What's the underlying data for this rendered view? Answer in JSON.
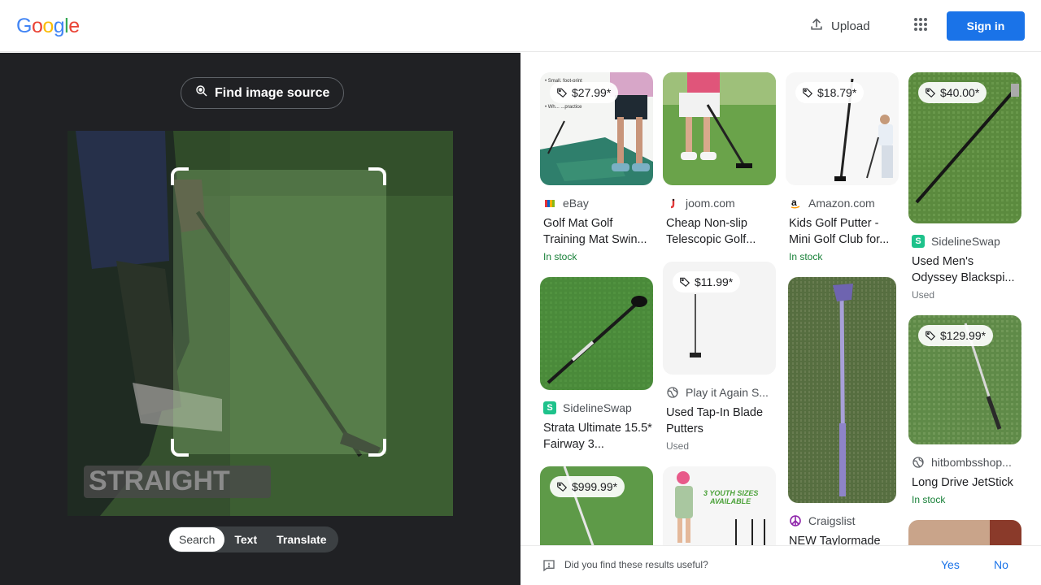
{
  "header": {
    "logo_letters": [
      "G",
      "o",
      "o",
      "g",
      "l",
      "e"
    ],
    "logo_colors": [
      "#4285F4",
      "#EA4335",
      "#FBBC05",
      "#4285F4",
      "#34A853",
      "#EA4335"
    ],
    "upload_label": "Upload",
    "signin_label": "Sign in"
  },
  "left_panel": {
    "find_source_label": "Find image source",
    "photo_overlay_text": "STRAIGHT",
    "tabs": [
      {
        "label": "Search",
        "active": true
      },
      {
        "label": "Text",
        "active": false
      },
      {
        "label": "Translate",
        "active": false
      }
    ]
  },
  "results": {
    "col1": [
      {
        "price": "$27.99*",
        "source": "eBay",
        "title": "Golf Mat Golf Training Mat Swin...",
        "availability": "In stock"
      },
      {
        "price": "",
        "source": "SidelineSwap",
        "title": "Strata Ultimate 15.5* Fairway 3...",
        "availability": ""
      },
      {
        "price": "$999.99*",
        "source": "",
        "title": "",
        "availability": ""
      }
    ],
    "col2": [
      {
        "price": "",
        "source": "joom.com",
        "title": "Cheap Non-slip Telescopic Golf...",
        "availability": ""
      },
      {
        "price": "$11.99*",
        "source": "Play it Again S...",
        "title": "Used Tap-In Blade Putters",
        "availability": "Used"
      },
      {
        "price": "",
        "source": "",
        "title": "",
        "availability": "",
        "thumb_text": "3 YOUTH SIZES AVAILABLE"
      }
    ],
    "col3": [
      {
        "price": "$18.79*",
        "source": "Amazon.com",
        "title": "Kids Golf Putter - Mini Golf Club for...",
        "availability": "In stock"
      },
      {
        "price": "",
        "source": "Craigslist",
        "title": "NEW Taylormade",
        "availability": ""
      }
    ],
    "col4": [
      {
        "price": "$40.00*",
        "source": "SidelineSwap",
        "title": "Used Men's Odyssey Blackspi...",
        "availability": "Used"
      },
      {
        "price": "$129.99*",
        "source": "hitbombsshop...",
        "title": "Long Drive JetStick",
        "availability": "In stock"
      }
    ]
  },
  "feedback": {
    "question": "Did you find these results useful?",
    "yes_label": "Yes",
    "no_label": "No"
  },
  "colors": {
    "accent_blue": "#1a73e8",
    "dark_panel": "#202124",
    "in_stock_green": "#188038"
  }
}
